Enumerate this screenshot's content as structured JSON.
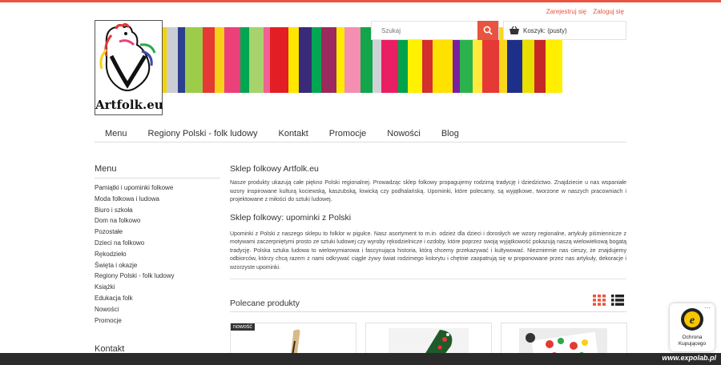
{
  "header": {
    "register": "Zarejestruj się",
    "login": "Zaloguj się",
    "logo_text": "Artfolk.eu",
    "search_placeholder": "Szukaj",
    "cart_label": "Koszyk: (pusty)"
  },
  "nav": [
    "Menu",
    "Regiony Polski - folk ludowy",
    "Kontakt",
    "Promocje",
    "Nowości",
    "Blog"
  ],
  "sidebar": {
    "title": "Menu",
    "items": [
      "Pamiątki i upominki folkowe",
      "Moda folkowa i ludowa",
      "Biuro i szkoła",
      "Dom na folkowo",
      "Pozostałe",
      "Dzieci na folkowo",
      "Rękodzieło",
      "Święta i okazje",
      "Regiony Polski - folk ludowy",
      "Książki",
      "Edukacja folk",
      "Nowości",
      "Promocje"
    ],
    "contact_title": "Kontakt"
  },
  "content": {
    "title": "Sklep folkowy Artfolk.eu",
    "intro": "Nasze produkty ukazują całe piękno Polski regionalnej. Prowadząc sklep folkowy propagujemy rodzimą tradycję i dziedzictwo. Znajdziecie u nas wspaniałe wzory inspirowane kulturą kociewską, kaszubską, łowicką czy podhalańską. Upominki, które polecamy, są wyjątkowe, tworzone w naszych pracowniach i projektowane z miłości do sztuki ludowej.",
    "subtitle": "Sklep folkowy: upominki z Polski",
    "body": "Upominki z Polski z naszego sklepu to folklor w pigułce. Nasz asortyment to m.in. odzież dla dzieci i dorosłych we wzory regionalne, artykuły piśmiennicze z motywami zaczerpniętymi prosto ze sztuki ludowej czy wyroby rękodzielnicze i ozdoby, które poprzez swoją wyjątkowość pokazują naszą wielowiekową bogatą tradycję. Polska sztuka ludowa to wielowymiarowa i fascynująca historia, którą chcemy przekazywać i kultywować. Niezmiernie nas cieszy, że znajdujemy odbiorców, którzy chcą razem z nami odkrywać ciągle żywy świat rodzimego kolorytu i chętnie zaopatrują się w proponowane przez nas artykuły, dekoracje i wzorzyste upominki."
  },
  "recommended": {
    "title": "Polecane produkty",
    "badge": "nowość"
  },
  "trust": {
    "label_line1": "Ochrona",
    "label_line2": "Kupującego",
    "dots": "···"
  },
  "watermark": "www.expolab.pl",
  "colors": {
    "accent": "#e8543f",
    "stripes": [
      "#e83a3a",
      "#ffec00",
      "#2aa84a",
      "#f48fb1",
      "#27a34a",
      "#f6d200",
      "#c9ced6",
      "#2c3f8f",
      "#9ccc4a",
      "#e53935",
      "#f7d117",
      "#ec407a",
      "#00a650",
      "#a8d26b",
      "#f06292",
      "#e31e24",
      "#ffe600",
      "#3a2a7a",
      "#00a651",
      "#9c2a5e",
      "#ffea00",
      "#f48fb1",
      "#12a54a",
      "#cfd3d8",
      "#e91e63",
      "#00a24a",
      "#fff200",
      "#d32f2f",
      "#ffe100",
      "#7b1fa2",
      "#2bb24c",
      "#ffeb3b",
      "#e53935",
      "#f9d71c",
      "#1e2f8a",
      "#e8e000",
      "#c62828",
      "#ffee00"
    ]
  }
}
